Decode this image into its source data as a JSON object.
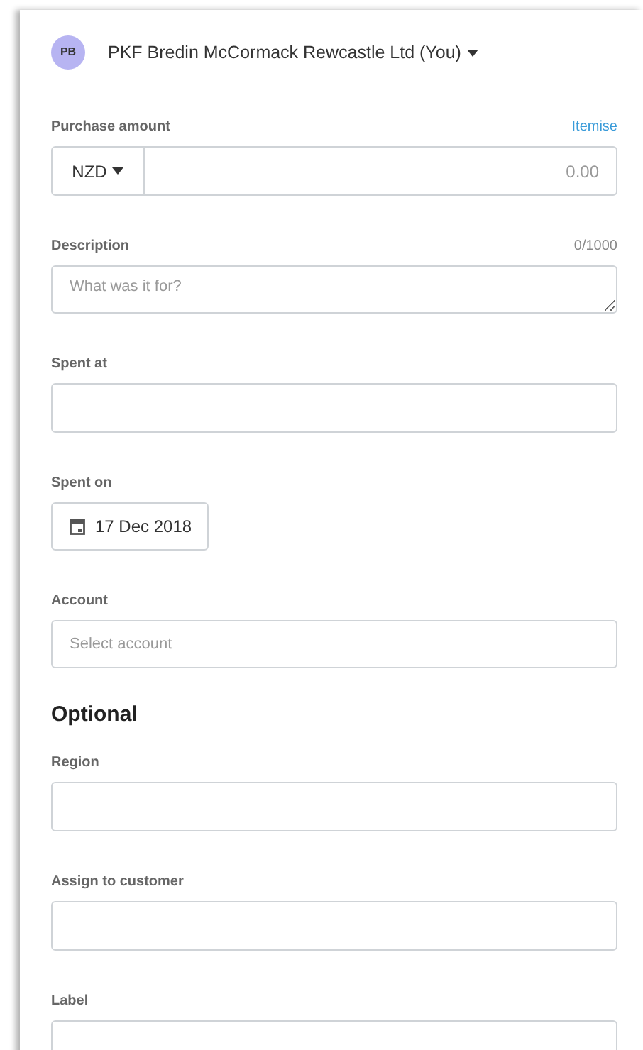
{
  "organisation": {
    "initials": "PB",
    "name": "PKF Bredin McCormack Rewcastle Ltd (You)"
  },
  "fields": [
    {
      "kind": "currency",
      "label": "Purchase amount",
      "link": "Itemise",
      "currency": "NZD",
      "placeholder": "0.00"
    },
    {
      "kind": "textarea",
      "label": "Description",
      "counter": "0/1000",
      "placeholder": "What was it for?"
    },
    {
      "kind": "text",
      "label": "Spent at"
    },
    {
      "kind": "date",
      "label": "Spent on",
      "value": "17 Dec 2018"
    },
    {
      "kind": "select",
      "label": "Account",
      "placeholder": "Select account"
    }
  ],
  "optional": {
    "heading": "Optional",
    "fields": [
      {
        "kind": "text",
        "label": "Region"
      },
      {
        "kind": "text",
        "label": "Assign to customer"
      },
      {
        "kind": "text",
        "label": "Label"
      }
    ]
  }
}
